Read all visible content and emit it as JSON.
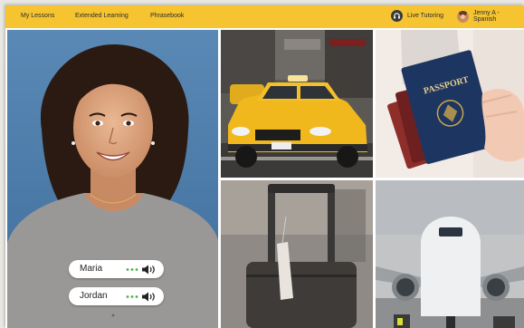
{
  "nav": {
    "links": [
      "My Lessons",
      "Extended Learning",
      "Phrasebook"
    ],
    "live_tutoring": "Live Tutoring",
    "user": "Jenny A - Spanish"
  },
  "participants": [
    {
      "name": "Maria"
    },
    {
      "name": "Jordan"
    }
  ],
  "scenes": {
    "passport_text": "PASSPORT"
  },
  "colors": {
    "nav_bg": "#f6c431",
    "speaking_dots": "#4cae4f"
  }
}
